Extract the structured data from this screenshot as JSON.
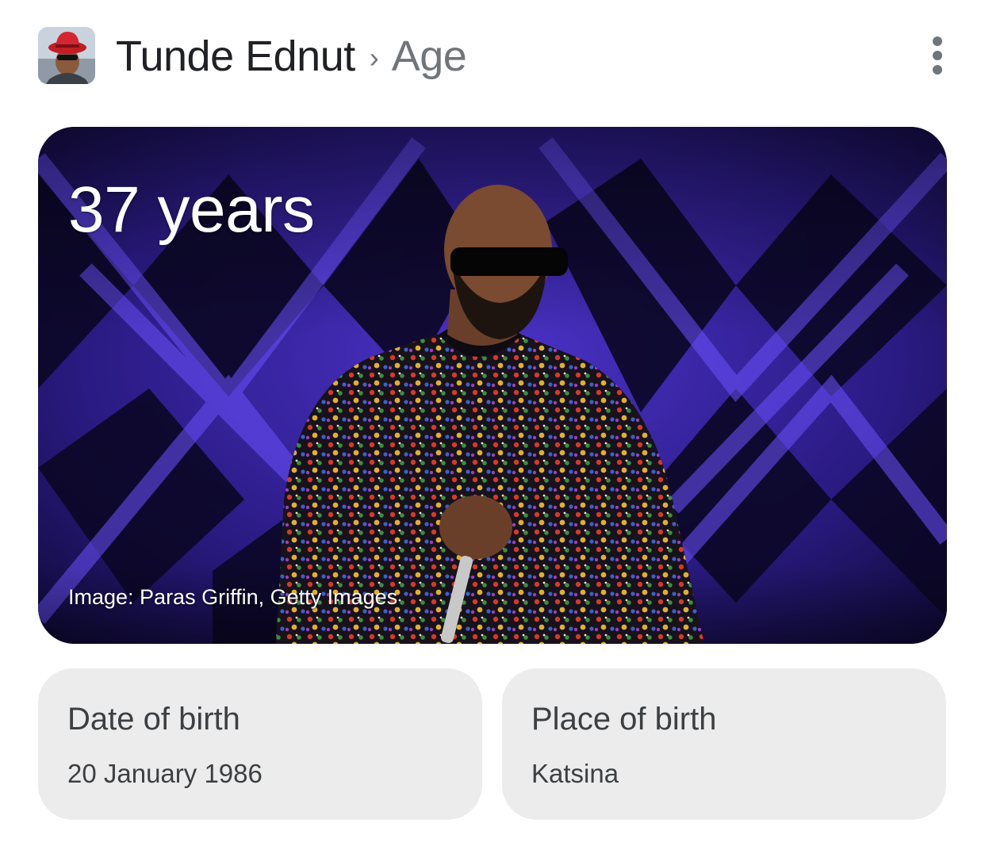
{
  "header": {
    "entity": "Tunde Ednut",
    "separator": "›",
    "attribute": "Age",
    "avatar_icon": "person-thumbnail",
    "menu_icon": "more-vert-icon"
  },
  "hero": {
    "age": "37 years",
    "credit": "Image: Paras Griffin, Getty Images"
  },
  "facts": [
    {
      "label": "Date of birth",
      "value": "20 January 1986"
    },
    {
      "label": "Place of birth",
      "value": "Katsina"
    }
  ],
  "colors": {
    "title_text": "#202124",
    "muted_text": "#70757a",
    "card_bg": "#ececec",
    "card_text": "#3c4043",
    "stage_purple": "#4a2fc9",
    "stage_dark": "#0b0725"
  }
}
